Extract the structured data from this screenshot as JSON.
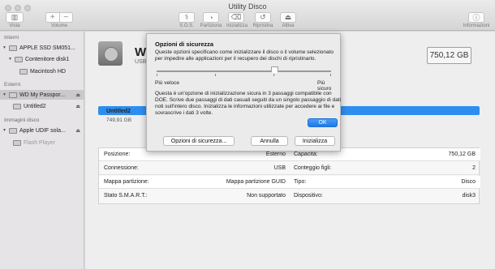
{
  "window": {
    "title": "Utility Disco"
  },
  "toolbar": {
    "vista_label": "Vista",
    "volume_label": "Volume",
    "volume_add": "+",
    "volume_remove": "−",
    "sos_label": "S.O.S.",
    "partiziona_label": "Partiziona",
    "inizializza_label": "Inizializza",
    "ripristina_label": "Ripristina",
    "attiva_label": "Attiva",
    "info_label": "Informazioni"
  },
  "sidebar": {
    "internal_header": "Interni",
    "external_header": "Esterni",
    "images_header": "Immagini disco",
    "items": [
      {
        "label": "APPLE SSD SM051..."
      },
      {
        "label": "Contenitore disk1"
      },
      {
        "label": "Macintosh HD"
      },
      {
        "label": "WD My Passpor..."
      },
      {
        "label": "Untitled2"
      },
      {
        "label": "Apple UDIF sola..."
      },
      {
        "label": "Flash Player"
      }
    ]
  },
  "main": {
    "disk_name": "W",
    "disk_sub": "USB",
    "capacity": "750,12 GB",
    "partition_name": "Untitled2",
    "partition_size": "749,91 GB"
  },
  "info_table": {
    "rows": [
      {
        "l_label": "Posizione:",
        "l_value": "Esterno",
        "r_label": "Capacità:",
        "r_value": "750,12 GB"
      },
      {
        "l_label": "Connessione:",
        "l_value": "USB",
        "r_label": "Conteggio figli:",
        "r_value": "2"
      },
      {
        "l_label": "Mappa partizione:",
        "l_value": "Mappa partizione GUID",
        "r_label": "Tipo:",
        "r_value": "Disco"
      },
      {
        "l_label": "Stato S.M.A.R.T.:",
        "l_value": "Non supportato",
        "r_label": "Dispositivo:",
        "r_value": "disk3"
      }
    ]
  },
  "dialog": {
    "title": "Opzioni di sicurezza",
    "text": "Queste opzioni specificano come inizializzare il disco o il volume selezionato per impedire alle applicazioni per il recupero dei dischi di ripristinarlo.",
    "slider_left": "Più veloce",
    "slider_right": "Più sicuro",
    "slider_level": 0.7,
    "description": "Questa è un'opzione di inizializzazione sicura in 3 passaggi compatibile con DOE. Scrive due passaggi di dati casuali seguiti da un singolo passaggio di dati noti sull'intero disco. Inizializza le informazioni utilizzate per accedere ai file e sovrascrive i dati 3 volte.",
    "ok_label": "OK"
  },
  "sheet_buttons": {
    "options_label": "Opzioni di sicurezza...",
    "cancel_label": "Annulla",
    "erase_label": "Inizializza"
  }
}
